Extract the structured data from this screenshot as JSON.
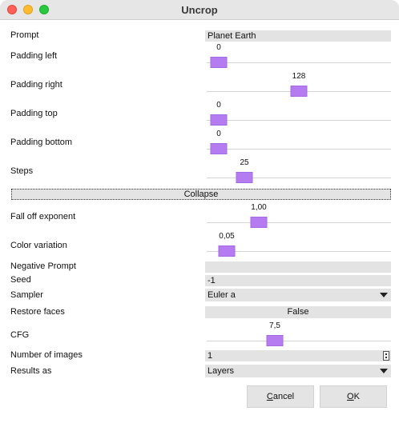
{
  "window": {
    "title": "Uncrop"
  },
  "form": {
    "prompt": {
      "label": "Prompt",
      "value": "Planet Earth"
    },
    "padding_left": {
      "label": "Padding left",
      "value": "0",
      "fraction": 0.0
    },
    "padding_right": {
      "label": "Padding right",
      "value": "128",
      "fraction": 0.5
    },
    "padding_top": {
      "label": "Padding top",
      "value": "0",
      "fraction": 0.0
    },
    "padding_bottom": {
      "label": "Padding bottom",
      "value": "0",
      "fraction": 0.0
    },
    "steps": {
      "label": "Steps",
      "value": "25",
      "fraction": 0.16
    },
    "collapse_label": "Collapse",
    "fall_off": {
      "label": "Fall off exponent",
      "value": "1,00",
      "fraction": 0.25
    },
    "color_variation": {
      "label": "Color variation",
      "value": "0,05",
      "fraction": 0.05
    },
    "negative_prompt": {
      "label": "Negative Prompt",
      "value": ""
    },
    "seed": {
      "label": "Seed",
      "value": "-1"
    },
    "sampler": {
      "label": "Sampler",
      "value": "Euler a"
    },
    "restore_faces": {
      "label": "Restore faces",
      "value": "False"
    },
    "cfg": {
      "label": "CFG",
      "value": "7,5",
      "fraction": 0.35
    },
    "num_images": {
      "label": "Number of images",
      "value": "1"
    },
    "results_as": {
      "label": "Results as",
      "value": "Layers"
    }
  },
  "buttons": {
    "cancel_mnemonic": "C",
    "cancel_rest": "ancel",
    "ok_mnemonic": "O",
    "ok_rest": "K"
  }
}
